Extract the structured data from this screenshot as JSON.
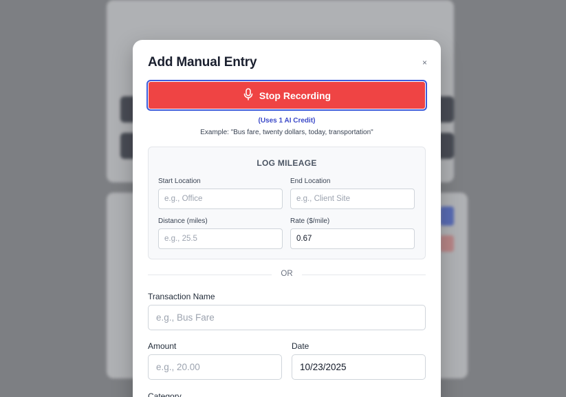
{
  "modal": {
    "title": "Add Manual Entry",
    "close_label": "×",
    "record_button_label": "Stop Recording",
    "record_icon": "microphone-icon",
    "credit_note": "(Uses 1 AI Credit)",
    "example_note": "Example: \"Bus fare, twenty dollars, today, transportation\""
  },
  "mileage": {
    "title": "LOG MILEAGE",
    "start_location": {
      "label": "Start Location",
      "placeholder": "e.g., Office",
      "value": ""
    },
    "end_location": {
      "label": "End Location",
      "placeholder": "e.g., Client Site",
      "value": ""
    },
    "distance": {
      "label": "Distance (miles)",
      "placeholder": "e.g., 25.5",
      "value": ""
    },
    "rate": {
      "label": "Rate ($/mile)",
      "placeholder": "",
      "value": "0.67"
    }
  },
  "divider": {
    "label": "OR"
  },
  "transaction": {
    "name": {
      "label": "Transaction Name",
      "placeholder": "e.g., Bus Fare",
      "value": ""
    },
    "amount": {
      "label": "Amount",
      "placeholder": "e.g., 20.00",
      "value": ""
    },
    "date": {
      "label": "Date",
      "value": "10/23/2025"
    },
    "category": {
      "label": "Category"
    }
  },
  "colors": {
    "record_button": "#ef4444",
    "focus_ring": "#3b5bdb",
    "credit_note": "#3b49c8",
    "overlay": "#7d7f83"
  }
}
